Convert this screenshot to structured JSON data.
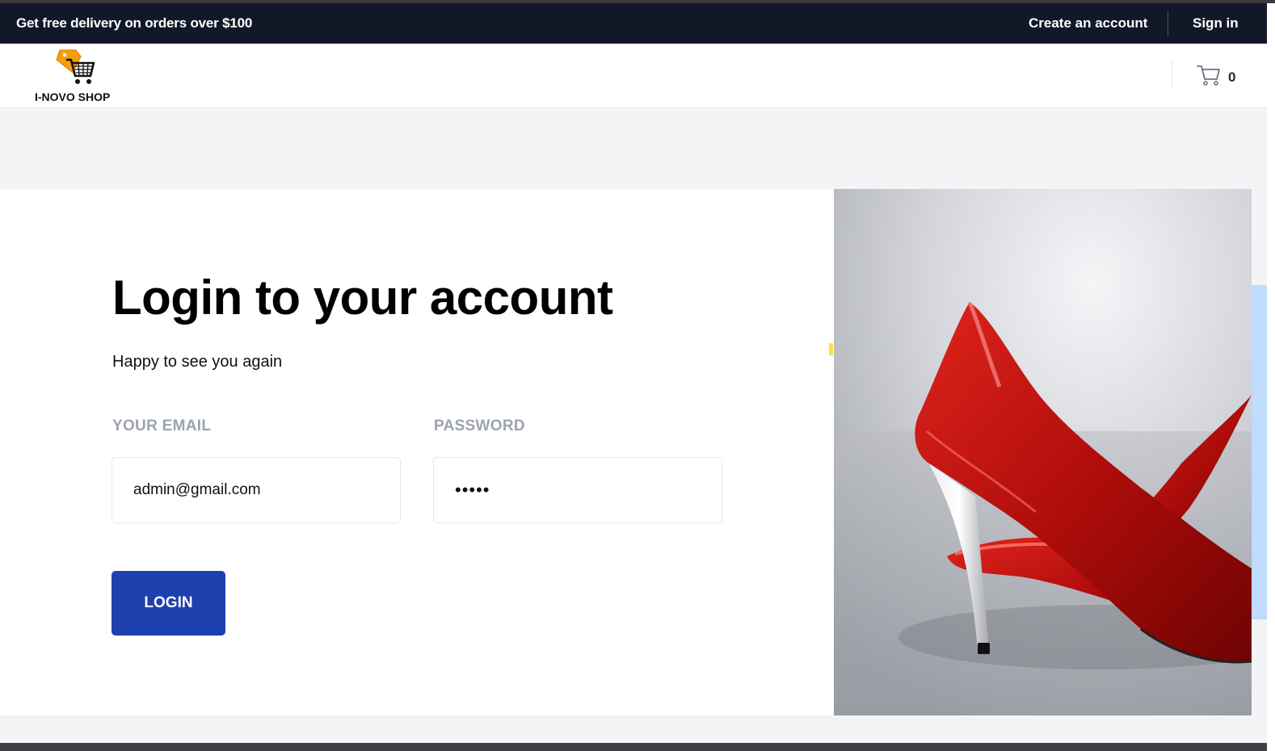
{
  "topbar": {
    "promo": "Get free delivery on orders over $100",
    "create_account": "Create an account",
    "sign_in": "Sign in",
    "background": "#111827"
  },
  "header": {
    "logo_text": "I-NOVO SHOP",
    "logo_icon": "shopping-cart-tag-icon",
    "cart_icon": "cart-icon",
    "cart_count": "0"
  },
  "login": {
    "title": "Login to your account",
    "subtitle": "Happy to see you again",
    "email_label": "YOUR EMAIL",
    "email_value": "admin@gmail.com",
    "password_label": "PASSWORD",
    "password_value": "•••••",
    "button_label": "LOGIN",
    "button_color": "#1e40af"
  },
  "hero": {
    "image_subject": "red-high-heel-shoes-image"
  }
}
